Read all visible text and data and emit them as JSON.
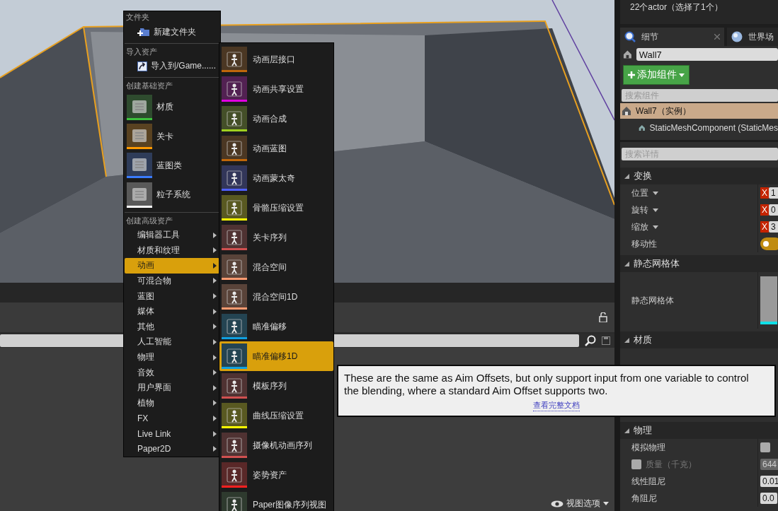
{
  "viewport": {
    "view_options": "视图选项"
  },
  "outliner": {
    "summary": "22个actor（选择了1个）"
  },
  "details_tabs": [
    {
      "label": "细节",
      "selected": true
    },
    {
      "label": "世界场",
      "selected": false
    }
  ],
  "actor_name": {
    "value": "Wall7"
  },
  "add_component_button": {
    "label": "添加组件"
  },
  "component_search": {
    "placeholder": "搜索组件"
  },
  "components": [
    {
      "label": "Wall7（实例）",
      "selected": true,
      "children": [
        {
          "label": "StaticMeshComponent (StaticMes",
          "selected": false
        }
      ]
    }
  ],
  "details_search": {
    "placeholder": "搜索详情"
  },
  "sections": [
    {
      "title": "变换",
      "rows": [
        {
          "label": "位置",
          "kind": "vector",
          "axis": "X",
          "value": "1"
        },
        {
          "label": "旋转",
          "kind": "vector",
          "axis": "X",
          "value": "0"
        },
        {
          "label": "缩放",
          "kind": "vector",
          "axis": "X",
          "value": "3"
        },
        {
          "label": "移动性",
          "kind": "toggle",
          "on": true
        }
      ]
    },
    {
      "title": "静态网格体",
      "rows": [
        {
          "label": "静态网格体",
          "kind": "thumbnail"
        }
      ]
    },
    {
      "title": "材质"
    },
    {
      "title": "物理",
      "rows": [
        {
          "label": "模拟物理",
          "kind": "checkbox",
          "checked": false
        },
        {
          "label": "质量（千克）",
          "kind": "checked-number",
          "checked": false,
          "disabled": true,
          "value": "644"
        },
        {
          "label": "线性阻尼",
          "kind": "number",
          "value": "0.01"
        },
        {
          "label": "角阻尼",
          "kind": "number",
          "value": "0.0"
        }
      ]
    }
  ],
  "context_menu": {
    "sections": [
      {
        "header": "文件夹",
        "items": [
          {
            "label": "新建文件夹",
            "kind": "new-folder"
          }
        ]
      },
      {
        "header": "导入资产",
        "items": [
          {
            "label": "导入到/Game......",
            "kind": "import"
          }
        ]
      },
      {
        "header": "创建基础资产",
        "items": [
          {
            "label": "材质",
            "kind": "asset",
            "color": "#3cc03c"
          },
          {
            "label": "关卡",
            "kind": "asset",
            "color": "#ff9900"
          },
          {
            "label": "蓝图类",
            "kind": "asset",
            "color": "#3a7cff"
          },
          {
            "label": "粒子系统",
            "kind": "asset",
            "color": "#ffffff"
          }
        ]
      },
      {
        "header": "创建高级资产",
        "items": [
          {
            "label": "编辑器工具",
            "kind": "submenu",
            "selected": false
          },
          {
            "label": "材质和纹理",
            "kind": "submenu",
            "selected": false
          },
          {
            "label": "动画",
            "kind": "submenu",
            "selected": true
          },
          {
            "label": "可混合物",
            "kind": "submenu",
            "selected": false
          },
          {
            "label": "蓝图",
            "kind": "submenu",
            "selected": false
          },
          {
            "label": "媒体",
            "kind": "submenu",
            "selected": false
          },
          {
            "label": "其他",
            "kind": "submenu",
            "selected": false
          },
          {
            "label": "人工智能",
            "kind": "submenu",
            "selected": false
          },
          {
            "label": "物理",
            "kind": "submenu",
            "selected": false
          },
          {
            "label": "音效",
            "kind": "submenu",
            "selected": false
          },
          {
            "label": "用户界面",
            "kind": "submenu",
            "selected": false
          },
          {
            "label": "植物",
            "kind": "submenu",
            "selected": false
          },
          {
            "label": "FX",
            "kind": "submenu",
            "selected": false
          },
          {
            "label": "Live Link",
            "kind": "submenu",
            "selected": false
          },
          {
            "label": "Paper2D",
            "kind": "submenu",
            "selected": false
          }
        ]
      }
    ]
  },
  "submenu": {
    "items": [
      {
        "label": "动画层接口",
        "color": "#c0670a",
        "selected": false
      },
      {
        "label": "动画共享设置",
        "color": "#e000e0",
        "selected": false
      },
      {
        "label": "动画合成",
        "color": "#a0d020",
        "selected": false
      },
      {
        "label": "动画蓝图",
        "color": "#c0670a",
        "selected": false
      },
      {
        "label": "动画蒙太奇",
        "color": "#5060ff",
        "selected": false
      },
      {
        "label": "骨骼压缩设置",
        "color": "#ffff00",
        "selected": false
      },
      {
        "label": "关卡序列",
        "color": "#d05050",
        "selected": false
      },
      {
        "label": "混合空间",
        "color": "#ff9a70",
        "selected": false
      },
      {
        "label": "混合空间1D",
        "color": "#ff9a70",
        "selected": false
      },
      {
        "label": "瞄准偏移",
        "color": "#10a0e0",
        "selected": false
      },
      {
        "label": "瞄准偏移1D",
        "color": "#10a0e0",
        "selected": true
      },
      {
        "label": "模板序列",
        "color": "#d05050",
        "selected": false
      },
      {
        "label": "曲线压缩设置",
        "color": "#ffff00",
        "selected": false
      },
      {
        "label": "摄像机动画序列",
        "color": "#d05050",
        "selected": false
      },
      {
        "label": "姿势资产",
        "color": "#ff2020",
        "selected": false
      },
      {
        "label": "Paper图像序列视图",
        "selected": false
      }
    ]
  },
  "tooltip": {
    "text": "These are the same as Aim Offsets, but only support input from one variable to control the blending, where a standard Aim Offset supports two.",
    "link": "查看完整文档"
  }
}
